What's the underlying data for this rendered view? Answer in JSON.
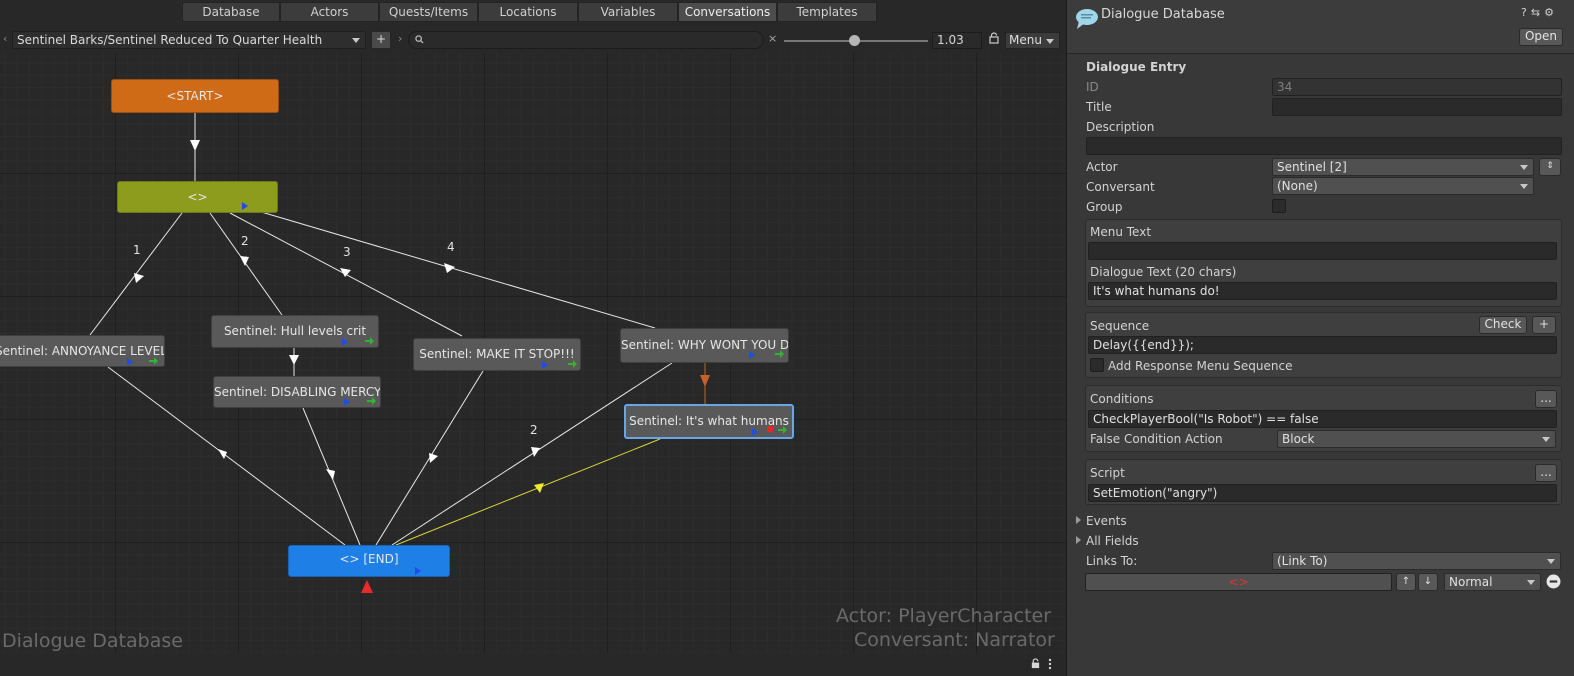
{
  "tabs": [
    "Database",
    "Actors",
    "Quests/Items",
    "Locations",
    "Variables",
    "Conversations",
    "Templates"
  ],
  "active_tab": "Conversations",
  "toolbar": {
    "back_arrow": "‹",
    "forward_arrow": "›",
    "conversation": "Sentinel Barks/Sentinel Reduced To Quarter Health",
    "add_label": "+",
    "search_value": "",
    "clear_label": "×",
    "zoom_value": "1.03",
    "menu_label": "Menu"
  },
  "graph": {
    "start": "<START>",
    "group": "<>",
    "end": "<> [END]",
    "nodes": [
      "Sentinel: ANNOYANCE LEVELS",
      "Sentinel: Hull levels crit",
      "Sentinel: DISABLING MERCY",
      "Sentinel: MAKE IT STOP!!!",
      "Sentinel: WHY WONT YOU DIE",
      "Sentinel: It's what humans"
    ],
    "link_numbers": [
      "1",
      "2",
      "3",
      "4",
      "2"
    ],
    "watermark": "Dialogue Database",
    "actor_label": "Actor: PlayerCharacter",
    "conversant_label": "Conversant: Narrator"
  },
  "inspector": {
    "title": "Dialogue Database",
    "open_label": "Open",
    "section_title": "Dialogue Entry",
    "id_label": "ID",
    "id_value": "34",
    "title_label": "Title",
    "title_value": "",
    "description_label": "Description",
    "description_value": "",
    "actor_label": "Actor",
    "actor_value": "Sentinel [2]",
    "conversant_label": "Conversant",
    "conversant_value": "(None)",
    "group_label": "Group",
    "menu_text_label": "Menu Text",
    "menu_text_value": "",
    "dialogue_text_label": "Dialogue Text (20 chars)",
    "dialogue_text_value": "It's what humans do!",
    "sequence_label": "Sequence",
    "check_label": "Check",
    "plus_label": "+",
    "sequence_value": "Delay({{end}});",
    "add_response_label": "Add Response Menu Sequence",
    "conditions_label": "Conditions",
    "ellipsis_label": "...",
    "conditions_value": "CheckPlayerBool(\"Is Robot\")  == false",
    "false_condition_label": "False Condition Action",
    "false_condition_value": "Block",
    "script_label": "Script",
    "script_value": "SetEmotion(\"angry\")",
    "events_label": "Events",
    "all_fields_label": "All Fields",
    "links_to_label": "Links To:",
    "links_to_value": "(Link To)",
    "link_entry_value": "<>",
    "priority_value": "Normal"
  }
}
